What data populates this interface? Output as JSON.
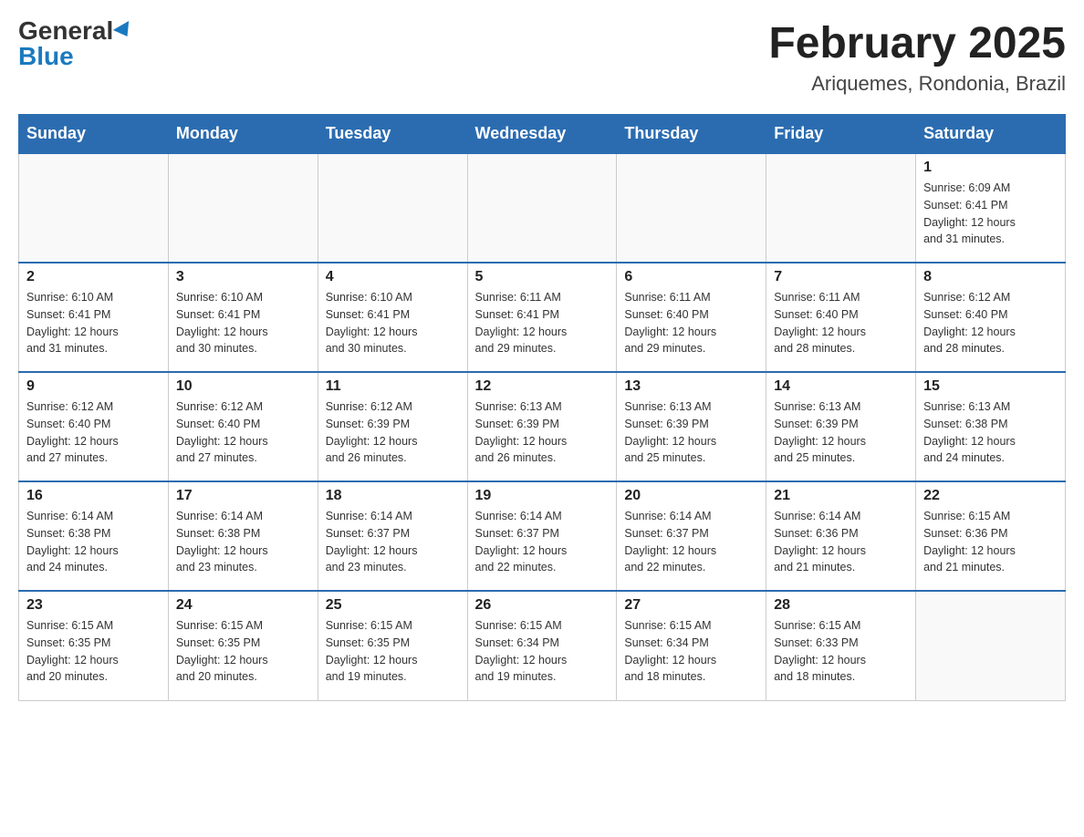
{
  "logo": {
    "general": "General",
    "blue": "Blue"
  },
  "title": "February 2025",
  "location": "Ariquemes, Rondonia, Brazil",
  "days_of_week": [
    "Sunday",
    "Monday",
    "Tuesday",
    "Wednesday",
    "Thursday",
    "Friday",
    "Saturday"
  ],
  "weeks": [
    [
      {
        "day": "",
        "info": ""
      },
      {
        "day": "",
        "info": ""
      },
      {
        "day": "",
        "info": ""
      },
      {
        "day": "",
        "info": ""
      },
      {
        "day": "",
        "info": ""
      },
      {
        "day": "",
        "info": ""
      },
      {
        "day": "1",
        "info": "Sunrise: 6:09 AM\nSunset: 6:41 PM\nDaylight: 12 hours\nand 31 minutes."
      }
    ],
    [
      {
        "day": "2",
        "info": "Sunrise: 6:10 AM\nSunset: 6:41 PM\nDaylight: 12 hours\nand 31 minutes."
      },
      {
        "day": "3",
        "info": "Sunrise: 6:10 AM\nSunset: 6:41 PM\nDaylight: 12 hours\nand 30 minutes."
      },
      {
        "day": "4",
        "info": "Sunrise: 6:10 AM\nSunset: 6:41 PM\nDaylight: 12 hours\nand 30 minutes."
      },
      {
        "day": "5",
        "info": "Sunrise: 6:11 AM\nSunset: 6:41 PM\nDaylight: 12 hours\nand 29 minutes."
      },
      {
        "day": "6",
        "info": "Sunrise: 6:11 AM\nSunset: 6:40 PM\nDaylight: 12 hours\nand 29 minutes."
      },
      {
        "day": "7",
        "info": "Sunrise: 6:11 AM\nSunset: 6:40 PM\nDaylight: 12 hours\nand 28 minutes."
      },
      {
        "day": "8",
        "info": "Sunrise: 6:12 AM\nSunset: 6:40 PM\nDaylight: 12 hours\nand 28 minutes."
      }
    ],
    [
      {
        "day": "9",
        "info": "Sunrise: 6:12 AM\nSunset: 6:40 PM\nDaylight: 12 hours\nand 27 minutes."
      },
      {
        "day": "10",
        "info": "Sunrise: 6:12 AM\nSunset: 6:40 PM\nDaylight: 12 hours\nand 27 minutes."
      },
      {
        "day": "11",
        "info": "Sunrise: 6:12 AM\nSunset: 6:39 PM\nDaylight: 12 hours\nand 26 minutes."
      },
      {
        "day": "12",
        "info": "Sunrise: 6:13 AM\nSunset: 6:39 PM\nDaylight: 12 hours\nand 26 minutes."
      },
      {
        "day": "13",
        "info": "Sunrise: 6:13 AM\nSunset: 6:39 PM\nDaylight: 12 hours\nand 25 minutes."
      },
      {
        "day": "14",
        "info": "Sunrise: 6:13 AM\nSunset: 6:39 PM\nDaylight: 12 hours\nand 25 minutes."
      },
      {
        "day": "15",
        "info": "Sunrise: 6:13 AM\nSunset: 6:38 PM\nDaylight: 12 hours\nand 24 minutes."
      }
    ],
    [
      {
        "day": "16",
        "info": "Sunrise: 6:14 AM\nSunset: 6:38 PM\nDaylight: 12 hours\nand 24 minutes."
      },
      {
        "day": "17",
        "info": "Sunrise: 6:14 AM\nSunset: 6:38 PM\nDaylight: 12 hours\nand 23 minutes."
      },
      {
        "day": "18",
        "info": "Sunrise: 6:14 AM\nSunset: 6:37 PM\nDaylight: 12 hours\nand 23 minutes."
      },
      {
        "day": "19",
        "info": "Sunrise: 6:14 AM\nSunset: 6:37 PM\nDaylight: 12 hours\nand 22 minutes."
      },
      {
        "day": "20",
        "info": "Sunrise: 6:14 AM\nSunset: 6:37 PM\nDaylight: 12 hours\nand 22 minutes."
      },
      {
        "day": "21",
        "info": "Sunrise: 6:14 AM\nSunset: 6:36 PM\nDaylight: 12 hours\nand 21 minutes."
      },
      {
        "day": "22",
        "info": "Sunrise: 6:15 AM\nSunset: 6:36 PM\nDaylight: 12 hours\nand 21 minutes."
      }
    ],
    [
      {
        "day": "23",
        "info": "Sunrise: 6:15 AM\nSunset: 6:35 PM\nDaylight: 12 hours\nand 20 minutes."
      },
      {
        "day": "24",
        "info": "Sunrise: 6:15 AM\nSunset: 6:35 PM\nDaylight: 12 hours\nand 20 minutes."
      },
      {
        "day": "25",
        "info": "Sunrise: 6:15 AM\nSunset: 6:35 PM\nDaylight: 12 hours\nand 19 minutes."
      },
      {
        "day": "26",
        "info": "Sunrise: 6:15 AM\nSunset: 6:34 PM\nDaylight: 12 hours\nand 19 minutes."
      },
      {
        "day": "27",
        "info": "Sunrise: 6:15 AM\nSunset: 6:34 PM\nDaylight: 12 hours\nand 18 minutes."
      },
      {
        "day": "28",
        "info": "Sunrise: 6:15 AM\nSunset: 6:33 PM\nDaylight: 12 hours\nand 18 minutes."
      },
      {
        "day": "",
        "info": ""
      }
    ]
  ]
}
